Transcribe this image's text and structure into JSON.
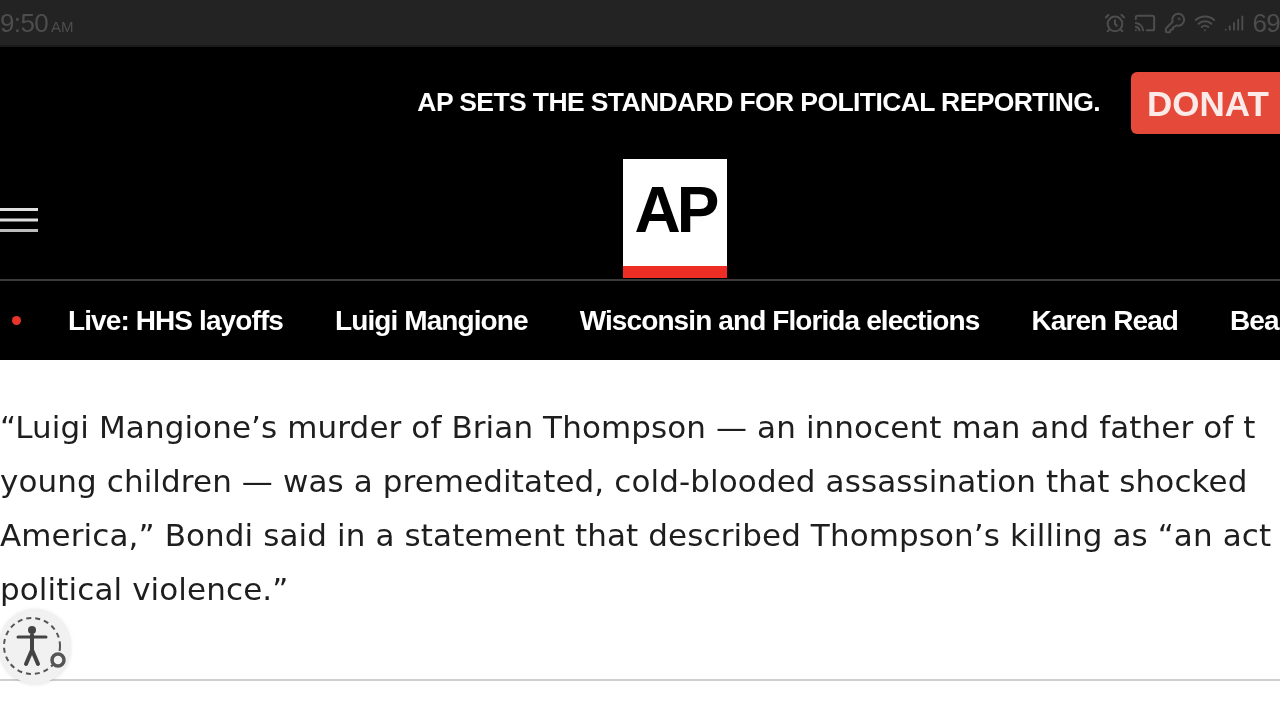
{
  "status_bar": {
    "time": "9:50",
    "meridiem": "AM",
    "battery": "69"
  },
  "promo_bar": {
    "tagline": "AP SETS THE STANDARD FOR POLITICAL REPORTING.",
    "donate_button": "DONAT"
  },
  "masthead": {
    "logo": "AP"
  },
  "topics": [
    {
      "label": "Live: HHS layoffs",
      "live": true
    },
    {
      "label": "Luigi Mangione",
      "live": false
    },
    {
      "label": "Wisconsin and Florida elections",
      "live": false
    },
    {
      "label": "Karen Read",
      "live": false
    },
    {
      "label": "Bea",
      "live": false
    }
  ],
  "article": {
    "lines": [
      "“Luigi Mangione’s murder of Brian Thompson — an innocent man and father of t",
      "young children — was a premeditated, cold-blooded assassination that shocked",
      "America,” Bondi said in a statement that described Thompson’s killing as “an act",
      "political violence.”"
    ]
  }
}
